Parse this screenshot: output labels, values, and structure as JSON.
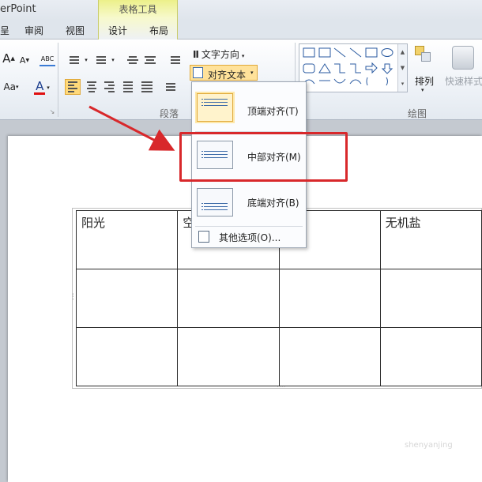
{
  "app_title": "erPoint",
  "context_tab_group": "表格工具",
  "tabs": [
    "呈",
    "审阅",
    "视图",
    "设计",
    "布局"
  ],
  "ribbon": {
    "text_direction": "文字方向",
    "align_text": "对齐文本",
    "arrange": "排列",
    "quick_styles": "快速样式",
    "font_color_letter": "A",
    "font_size_up": "A",
    "font_size_down": "A",
    "change_case": "Aa",
    "spell": "ABC",
    "groups": {
      "paragraph": "段落",
      "drawing": "绘图"
    }
  },
  "align_menu": {
    "items": [
      {
        "label": "顶端对齐(T)"
      },
      {
        "label": "中部对齐(M)"
      },
      {
        "label": "底端对齐(B)"
      }
    ],
    "more_options": "其他选项(O)..."
  },
  "table": {
    "rows": [
      [
        "阳光",
        "空",
        "",
        "无机盐"
      ],
      [
        "",
        "",
        "",
        ""
      ],
      [
        "",
        "",
        "",
        ""
      ]
    ]
  },
  "watermark": "shenyanjing",
  "colors": {
    "highlight_red": "#d8282b",
    "active_button": "#ffe29a",
    "font_color_bar": "#e01010"
  }
}
